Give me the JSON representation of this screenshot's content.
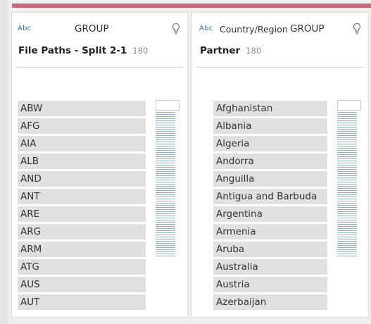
{
  "panels": [
    {
      "type_badge": "Abc",
      "role_label": "GROUP",
      "sub_label": "",
      "field_name": "File Paths - Split 2-1",
      "count": "180",
      "values": [
        "ABW",
        "AFG",
        "AIA",
        "ALB",
        "AND",
        "ANT",
        "ARE",
        "ARG",
        "ARM",
        "ATG",
        "AUS",
        "AUT"
      ]
    },
    {
      "type_badge": "Abc",
      "role_label": "GROUP",
      "sub_label": "Country/Region",
      "field_name": "Partner",
      "count": "180",
      "values": [
        "Afghanistan",
        "Albania",
        "Algeria",
        "Andorra",
        "Anguilla",
        "Antigua and Barbuda",
        "Argentina",
        "Armenia",
        "Aruba",
        "Australia",
        "Austria",
        "Azerbaijan"
      ]
    }
  ],
  "colors": {
    "accent_bar": "#c86879",
    "badge": "#3a6fa8",
    "histogram": "#8eabcd"
  },
  "icons": {
    "suggestion": "lightbulb-icon"
  }
}
